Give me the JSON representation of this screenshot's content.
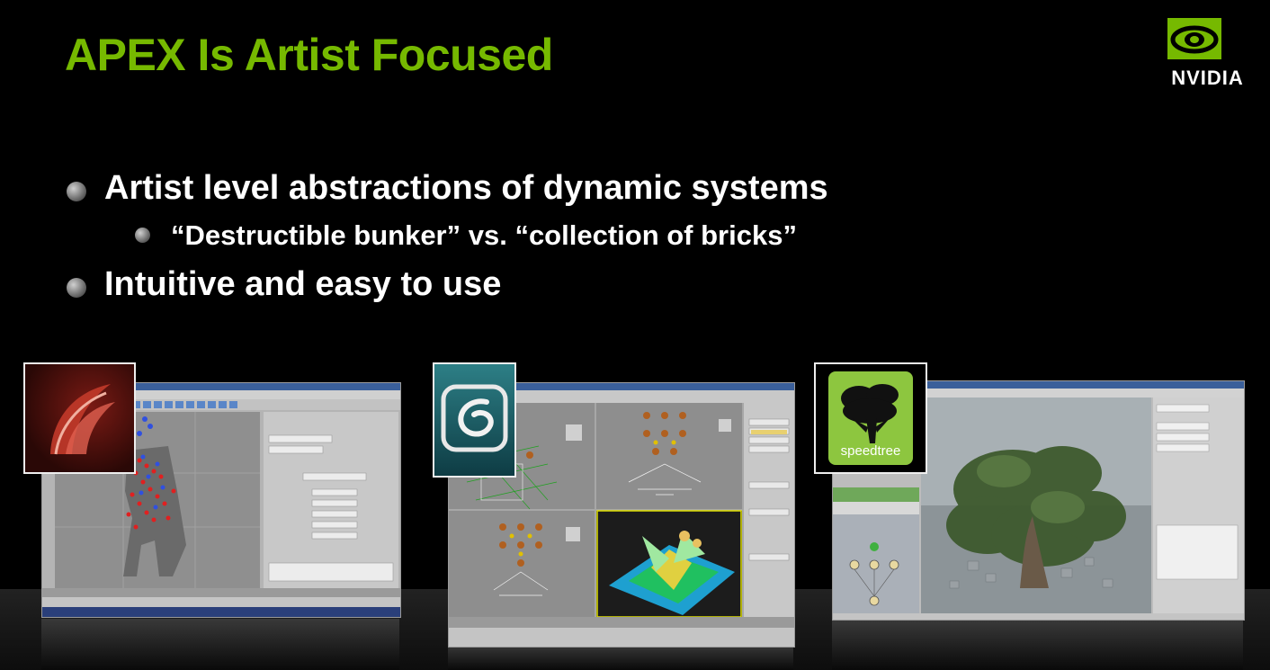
{
  "slide": {
    "title": "APEX Is Artist Focused",
    "bullets": [
      "Artist level abstractions of dynamic systems",
      "“Destructible bunker” vs. “collection of bricks”",
      "Intuitive and easy to use"
    ]
  },
  "logo": {
    "wordmark": "NVIDIA"
  },
  "screenshots": {
    "maya": {
      "icon": "maya-icon"
    },
    "max": {
      "icon": "3dsmax-icon"
    },
    "speedtree": {
      "icon": "speedtree-icon",
      "label": "speedtree"
    }
  },
  "colors": {
    "accent": "#76b900",
    "text": "#ffffff",
    "background": "#000000"
  }
}
